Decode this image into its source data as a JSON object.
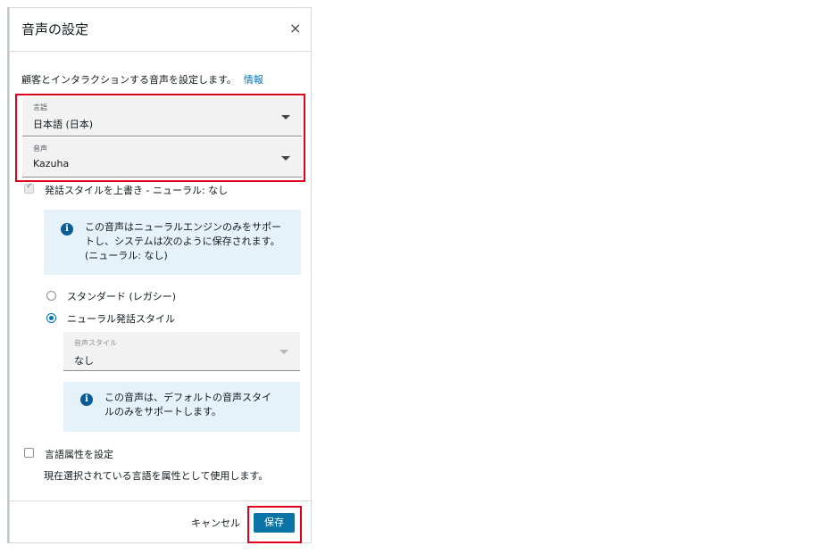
{
  "dialog": {
    "title": "音声の設定",
    "close_symbol": "×",
    "description": "顧客とインタラクションする音声を設定します。",
    "info_link": "情報"
  },
  "language_select": {
    "label": "言語",
    "value": "日本語 (日本)"
  },
  "voice_select": {
    "label": "音声",
    "value": "Kazuha"
  },
  "override_checkbox": {
    "label": "発話スタイルを上書き - ニューラル: なし",
    "checked": true,
    "disabled": true
  },
  "alert_neural": {
    "icon": "info-icon",
    "line1": "この音声はニューラルエンジンのみをサポー",
    "line2": "トし、システムは次のように保存されます。",
    "line3": "(ニューラル: なし)"
  },
  "radio_options": [
    {
      "label": "スタンダード (レガシー)",
      "selected": false
    },
    {
      "label": "ニューラル発話スタイル",
      "selected": true
    }
  ],
  "speaking_style_select": {
    "label": "音声スタイル",
    "value": "なし",
    "disabled": true
  },
  "alert_style": {
    "icon": "info-icon",
    "line1": "この音声は、デフォルトの音声スタイ",
    "line2": "ルのみをサポートします。"
  },
  "language_attr_checkbox": {
    "label": "言語属性を設定",
    "checked": false
  },
  "language_attr_hint": "現在選択されている言語を属性として使用します。",
  "footer": {
    "cancel_label": "キャンセル",
    "save_label": "保存"
  },
  "colors": {
    "primary": "#0a74a6",
    "link": "#0073bb",
    "highlight": "#e0001b",
    "alert_bg": "#e6f2fa"
  }
}
